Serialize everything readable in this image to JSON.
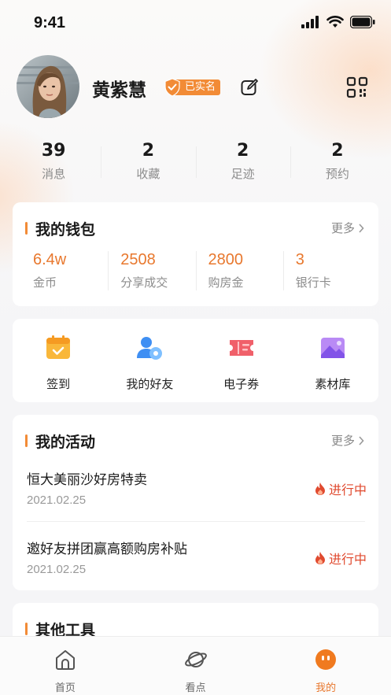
{
  "status_bar": {
    "time": "9:41"
  },
  "profile": {
    "name": "黄紫慧",
    "verified_label": "已实名"
  },
  "stats": [
    {
      "value": "39",
      "label": "消息"
    },
    {
      "value": "2",
      "label": "收藏"
    },
    {
      "value": "2",
      "label": "足迹"
    },
    {
      "value": "2",
      "label": "预约"
    }
  ],
  "wallet": {
    "title": "我的钱包",
    "more": "更多",
    "items": [
      {
        "value": "6.4w",
        "label": "金币"
      },
      {
        "value": "2508",
        "label": "分享成交"
      },
      {
        "value": "2800",
        "label": "购房金"
      },
      {
        "value": "3",
        "label": "银行卡"
      }
    ]
  },
  "tools": [
    {
      "label": "签到",
      "icon": "calendar-check-icon"
    },
    {
      "label": "我的好友",
      "icon": "friends-icon"
    },
    {
      "label": "电子券",
      "icon": "coupon-icon"
    },
    {
      "label": "素材库",
      "icon": "image-library-icon"
    }
  ],
  "activities": {
    "title": "我的活动",
    "more": "更多",
    "items": [
      {
        "title": "恒大美丽沙好房特卖",
        "date": "2021.02.25",
        "status": "进行中"
      },
      {
        "title": "邀好友拼团赢高额购房补贴",
        "date": "2021.02.25",
        "status": "进行中"
      }
    ]
  },
  "other_tools": {
    "title": "其他工具"
  },
  "tabbar": {
    "items": [
      {
        "label": "首页",
        "icon": "home-icon"
      },
      {
        "label": "看点",
        "icon": "planet-icon"
      },
      {
        "label": "我的",
        "icon": "profile-face-icon"
      }
    ],
    "active": "我的"
  },
  "colors": {
    "accent": "#f28b36",
    "accent_text": "#e8782e",
    "status_red": "#e04a2f"
  }
}
